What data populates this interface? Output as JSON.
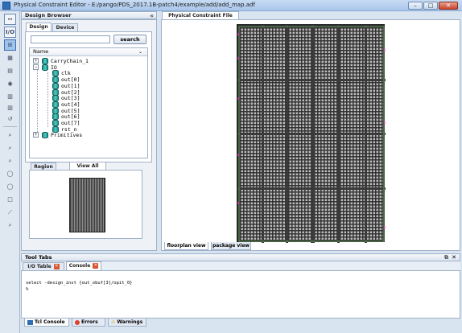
{
  "window": {
    "title": "Physical Constraint Editor - E:/pango/PDS_2017.1B-patch4/example/add/add_map.adf",
    "min": "–",
    "max": "□",
    "close": "✕"
  },
  "toolbar": {
    "items": [
      "↔",
      "I/O",
      "⊞",
      "▦",
      "▤",
      "◉",
      "▥",
      "▥",
      "↺",
      "⌕",
      "⌕",
      "⌕",
      "◯",
      "◯",
      "□",
      "⟋",
      "⌕"
    ]
  },
  "design_browser": {
    "title": "Design Browser",
    "collapse": "«",
    "tabs": [
      "Design",
      "Device"
    ],
    "search_button": "search",
    "search_value": "",
    "column": "Name",
    "tree": [
      {
        "label": "CarryChain_1",
        "level": 0,
        "expander": "+",
        "icon": "db"
      },
      {
        "label": "IO",
        "level": 0,
        "expander": "−",
        "icon": "db"
      },
      {
        "label": "clk",
        "level": 1,
        "icon": "db"
      },
      {
        "label": "out[0]",
        "level": 1,
        "icon": "db"
      },
      {
        "label": "out[1]",
        "level": 1,
        "icon": "db"
      },
      {
        "label": "out[2]",
        "level": 1,
        "icon": "db"
      },
      {
        "label": "out[3]",
        "level": 1,
        "icon": "db"
      },
      {
        "label": "out[4]",
        "level": 1,
        "icon": "db"
      },
      {
        "label": "out[5]",
        "level": 1,
        "icon": "db"
      },
      {
        "label": "out[6]",
        "level": 1,
        "icon": "db"
      },
      {
        "label": "out[7]",
        "level": 1,
        "icon": "db"
      },
      {
        "label": "rst_n",
        "level": 1,
        "icon": "db"
      },
      {
        "label": "Primitives",
        "level": 0,
        "expander": "+",
        "icon": "db"
      }
    ]
  },
  "overview": {
    "tabs": [
      "Region",
      "View All"
    ]
  },
  "main": {
    "tab": "Physical Constraint File",
    "bottom_tabs": [
      "floorplan view",
      "package view"
    ]
  },
  "tool_tabs": {
    "title": "Tool Tabs",
    "tabs": [
      "I/O Table",
      "Console"
    ],
    "console_lines": [
      "select -design_inst {out_obuf[3]/opit_0}",
      "%"
    ],
    "bottom_tabs": [
      "Tcl Console",
      "Errors",
      "Warnings"
    ]
  },
  "colors": {
    "accent": "#3c6fb0",
    "teal_icon": "#2aa8a1",
    "fpga_bg": "#2a2a2a"
  }
}
